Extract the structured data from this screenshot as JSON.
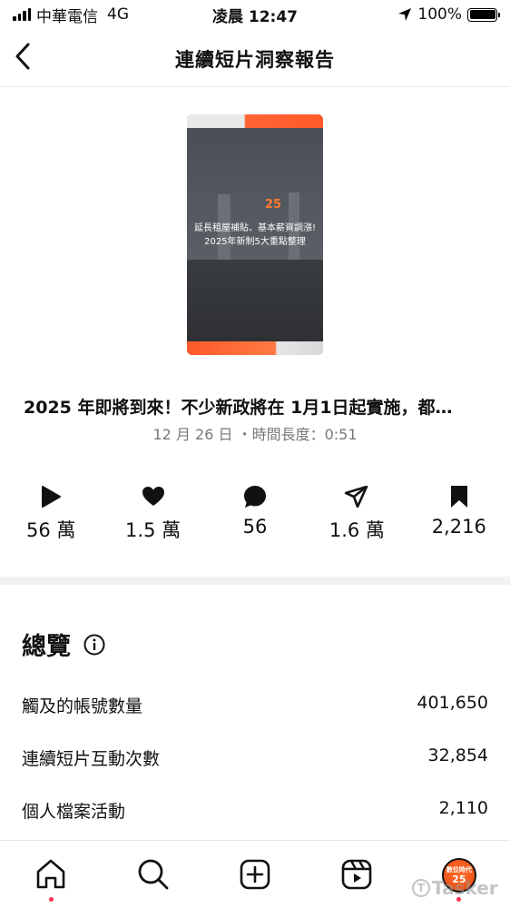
{
  "status_bar": {
    "carrier": "中華電信",
    "network": "4G",
    "time": "凌晨 12:47",
    "battery": "100%"
  },
  "header": {
    "title": "連續短片洞察報告",
    "back_icon": "chevron-left-icon"
  },
  "thumbnail": {
    "logo_text": "25",
    "line1": "延長租屋補貼、基本薪資調漲!",
    "line2": "2025年新制5大重點整理"
  },
  "post": {
    "title": "2025 年即將到來！不少新政將在 1月1日起實施，都…",
    "meta": "12 月 26 日 ・時間長度：0:51"
  },
  "stats": [
    {
      "icon": "play-icon",
      "value": "56 萬"
    },
    {
      "icon": "heart-icon",
      "value": "1.5 萬"
    },
    {
      "icon": "comment-icon",
      "value": "56"
    },
    {
      "icon": "share-icon",
      "value": "1.6 萬"
    },
    {
      "icon": "bookmark-icon",
      "value": "2,216"
    }
  ],
  "overview": {
    "title": "總覽",
    "rows": [
      {
        "label": "觸及的帳號數量",
        "value": "401,650"
      },
      {
        "label": "連續短片互動次數",
        "value": "32,854"
      },
      {
        "label": "個人檔案活動",
        "value": "2,110"
      }
    ]
  },
  "bottom_nav": {
    "items": [
      "home-icon",
      "search-icon",
      "create-icon",
      "reels-icon",
      "profile-avatar"
    ],
    "avatar_top": "數位時代",
    "avatar_num": "25"
  },
  "watermark": "Tasker",
  "colors": {
    "accent_orange": "#ff5a2a",
    "notification_dot": "#ff2d55"
  }
}
